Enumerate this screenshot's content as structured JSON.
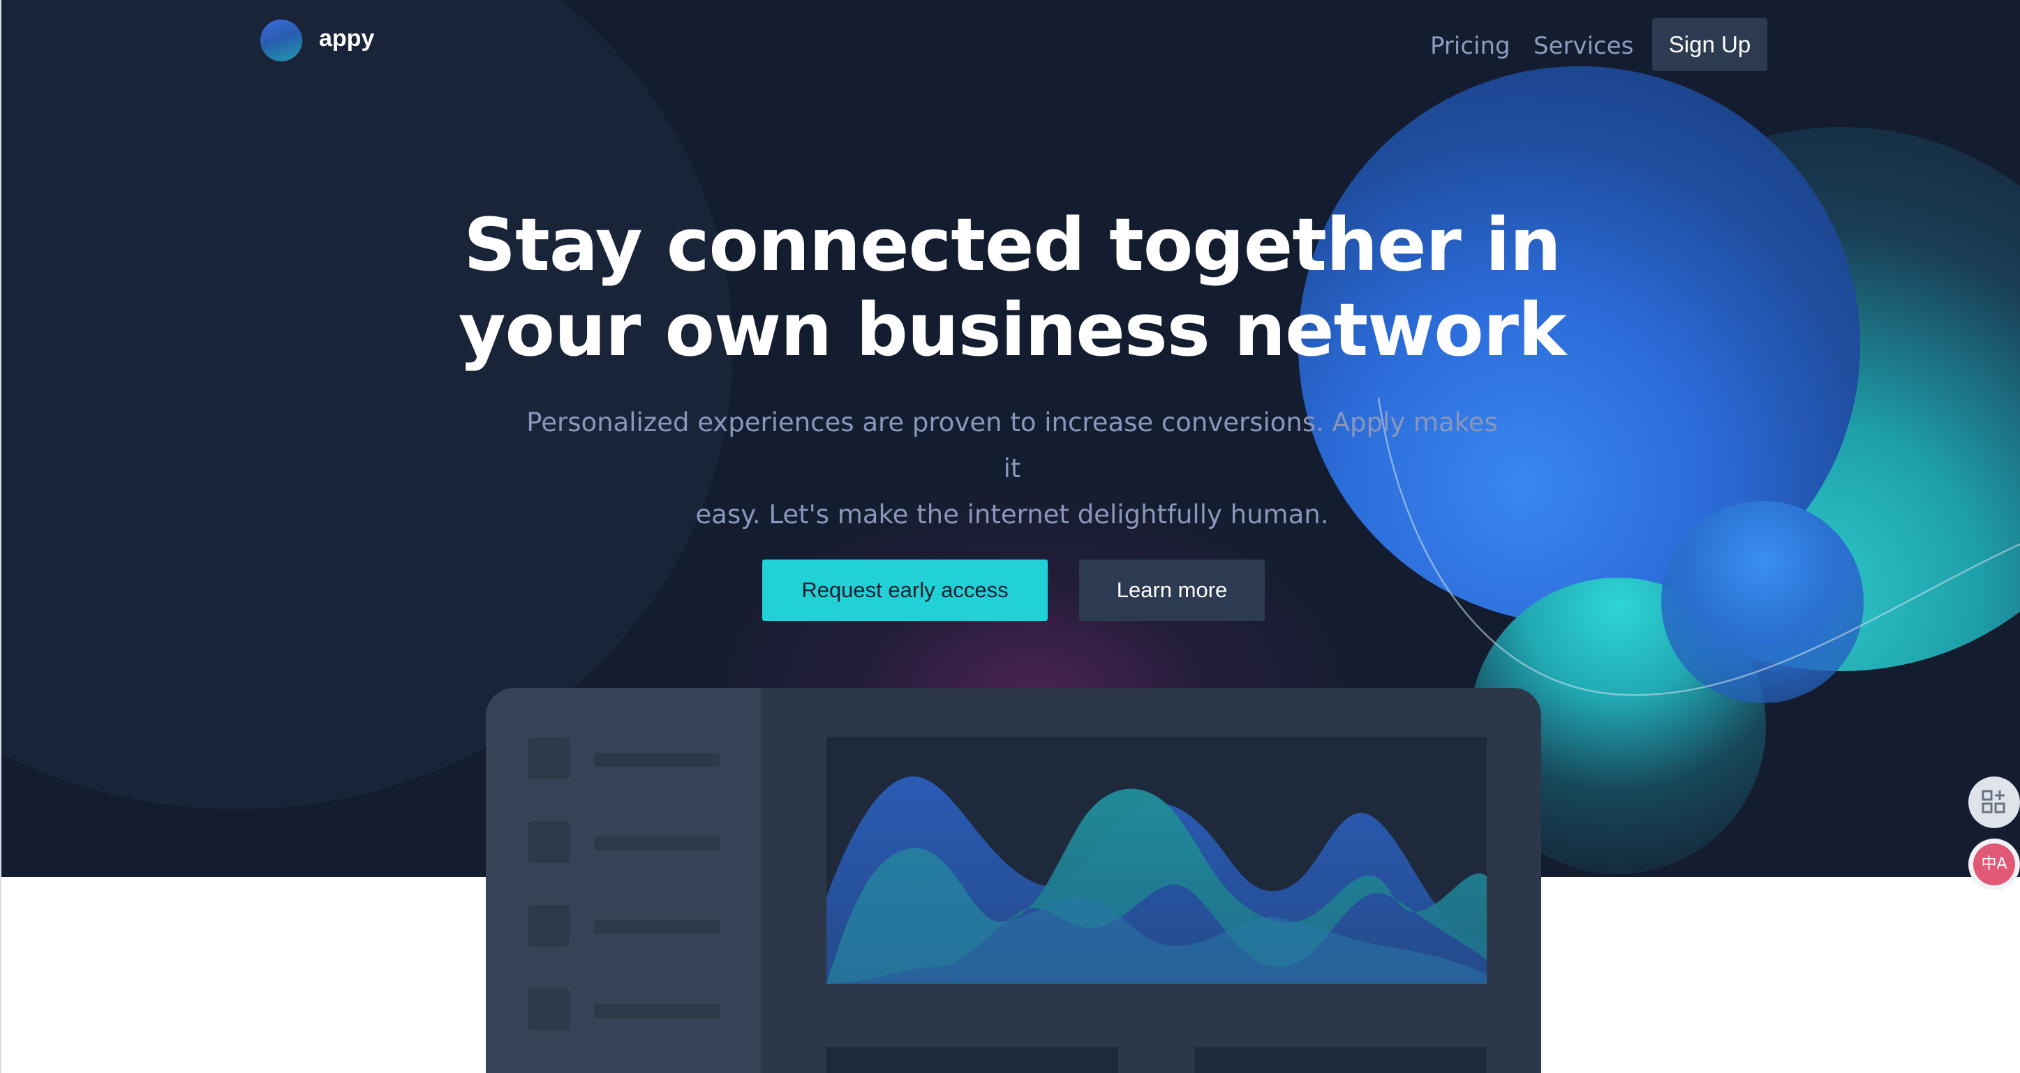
{
  "brand": {
    "name": "appy"
  },
  "nav": {
    "links": [
      "Pricing",
      "Services"
    ],
    "signup_label": "Sign Up"
  },
  "hero": {
    "headline_line1": "Stay connected together in",
    "headline_line2": "your own business network",
    "subtitle_line1": "Personalized experiences are proven to increase conversions. Apply makes it",
    "subtitle_line2": "easy. Let's make the internet delightfully human.",
    "primary_cta": "Request early access",
    "secondary_cta": "Learn more"
  },
  "side_widgets": {
    "apps_icon": "apps-add-icon",
    "translate_label": "中A"
  },
  "colors": {
    "hero_bg": "#141d2f",
    "accent_teal": "#22d1d6",
    "accent_blue": "#3a86f0",
    "button_dark": "#2c3a52",
    "muted_text": "#8a96bb"
  }
}
